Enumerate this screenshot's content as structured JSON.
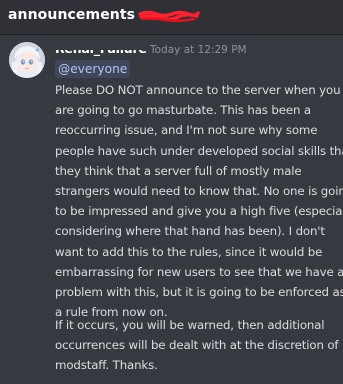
{
  "header": {
    "channel_name": "announcements",
    "redaction_color": "#ff2030"
  },
  "message": {
    "author": "Renai_Failure",
    "timestamp": "Today at 12:29 PM",
    "mention": "@everyone",
    "paragraphs": [
      [
        "Please DO NOT announce to the server when you",
        "are going to go masturbate. This has been a",
        "reoccurring issue, and I'm not sure why some",
        "people have such under developed social skills that",
        "they think that a server full of mostly male",
        "strangers would need to know that. No one is going",
        "to be impressed and give you a high five (especially",
        "considering where that hand has been). I don't",
        "want to add this to the rules, since it would be",
        "embarrassing for new users to see that we have a",
        "problem with this, but it is going to be enforced as",
        "a rule from now on."
      ],
      [
        "If it occurs, you will be warned, then additional",
        "occurrences will be dealt with at the discretion of",
        "modstaff. Thanks."
      ]
    ]
  },
  "colors": {
    "background": "#36393f",
    "header_background": "#2f3136",
    "text": "#dcddde",
    "timestamp": "#8e9297",
    "mention_text": "#b4c1f3"
  }
}
